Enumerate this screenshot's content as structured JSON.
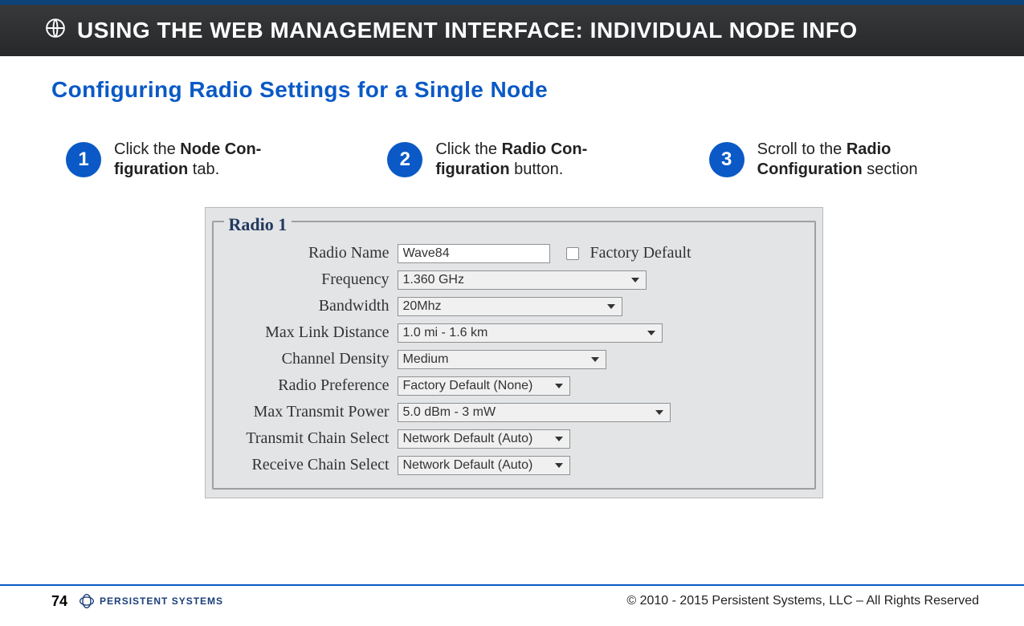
{
  "header": {
    "icon_name": "globe-icon",
    "title": "USING THE WEB MANAGEMENT INTERFACE:  INDIVIDUAL NODE INFO"
  },
  "section_title": "Configuring Radio Settings for a Single Node",
  "steps": {
    "s1": {
      "num": "1",
      "pre": "Click the ",
      "bold": "Node Con-figuration",
      "post": " tab."
    },
    "s2": {
      "num": "2",
      "pre": "Click the ",
      "bold": "Radio Con-figuration",
      "post": " button."
    },
    "s3": {
      "num": "3",
      "pre": "Scroll to the ",
      "bold": "Radio Configuration",
      "post": " section"
    }
  },
  "radio_panel": {
    "legend": "Radio 1",
    "labels": {
      "radio_name": "Radio Name",
      "factory_default": "Factory Default",
      "frequency": "Frequency",
      "bandwidth": "Bandwidth",
      "max_link_distance": "Max Link Distance",
      "channel_density": "Channel Density",
      "radio_preference": "Radio Preference",
      "max_transmit_power": "Max Transmit Power",
      "transmit_chain_select": "Transmit Chain Select",
      "receive_chain_select": "Receive Chain Select"
    },
    "values": {
      "radio_name": "Wave84",
      "factory_default_checked": false,
      "frequency": "1.360 GHz",
      "bandwidth": "20Mhz",
      "max_link_distance": "1.0 mi - 1.6 km",
      "channel_density": "Medium",
      "radio_preference": "Factory Default (None)",
      "max_transmit_power": "5.0 dBm - 3 mW",
      "transmit_chain_select": "Network Default (Auto)",
      "receive_chain_select": "Network Default (Auto)"
    }
  },
  "footer": {
    "page_number": "74",
    "logo_text": "PERSISTENT SYSTEMS",
    "copyright": "© 2010 - 2015 Persistent Systems, LLC – All Rights Reserved"
  }
}
